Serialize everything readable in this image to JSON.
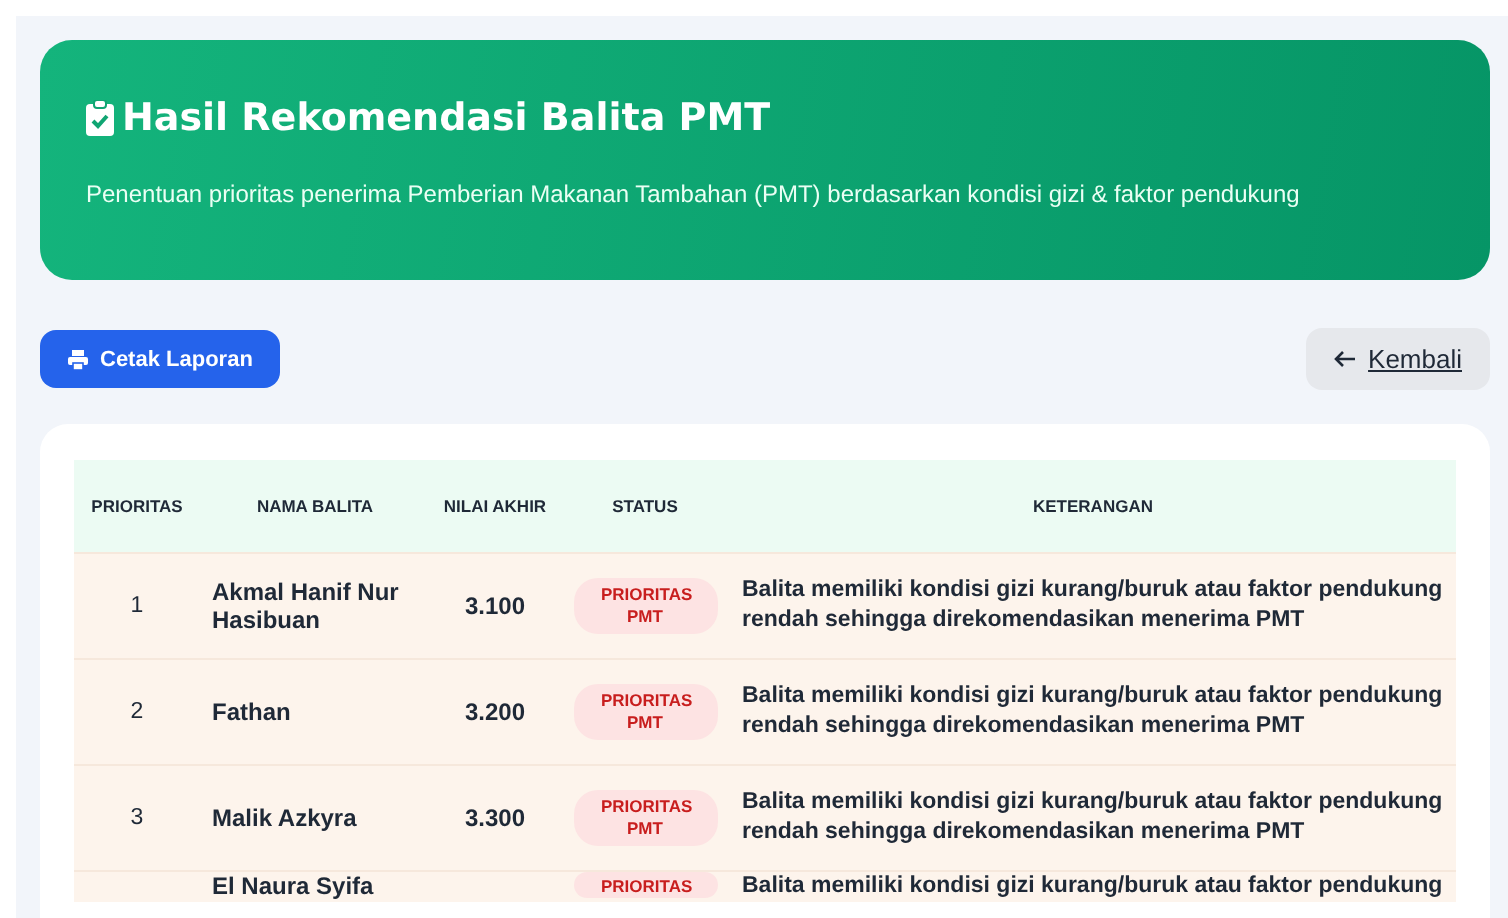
{
  "header": {
    "title": "Hasil Rekomendasi Balita PMT",
    "subtitle": "Penentuan prioritas penerima Pemberian Makanan Tambahan (PMT) berdasarkan kondisi gizi & faktor pendukung"
  },
  "actions": {
    "print": "Cetak Laporan",
    "back": "Kembali"
  },
  "table": {
    "columns": [
      "PRIORITAS",
      "NAMA BALITA",
      "NILAI AKHIR",
      "STATUS",
      "KETERANGAN"
    ],
    "rows": [
      {
        "priority": "1",
        "name": "Akmal Hanif Nur Hasibuan",
        "score": "3.100",
        "status": "PRIORITAS PMT",
        "note": "Balita memiliki kondisi gizi kurang/buruk atau faktor pendukung rendah sehingga direkomendasikan menerima PMT"
      },
      {
        "priority": "2",
        "name": "Fathan",
        "score": "3.200",
        "status": "PRIORITAS PMT",
        "note": "Balita memiliki kondisi gizi kurang/buruk atau faktor pendukung rendah sehingga direkomendasikan menerima PMT"
      },
      {
        "priority": "3",
        "name": "Malik Azkyra",
        "score": "3.300",
        "status": "PRIORITAS PMT",
        "note": "Balita memiliki kondisi gizi kurang/buruk atau faktor pendukung rendah sehingga direkomendasikan menerima PMT"
      },
      {
        "name": "El Naura Syifa",
        "status": "PRIORITAS",
        "note": "Balita memiliki kondisi gizi kurang/buruk atau faktor pendukung"
      }
    ]
  }
}
